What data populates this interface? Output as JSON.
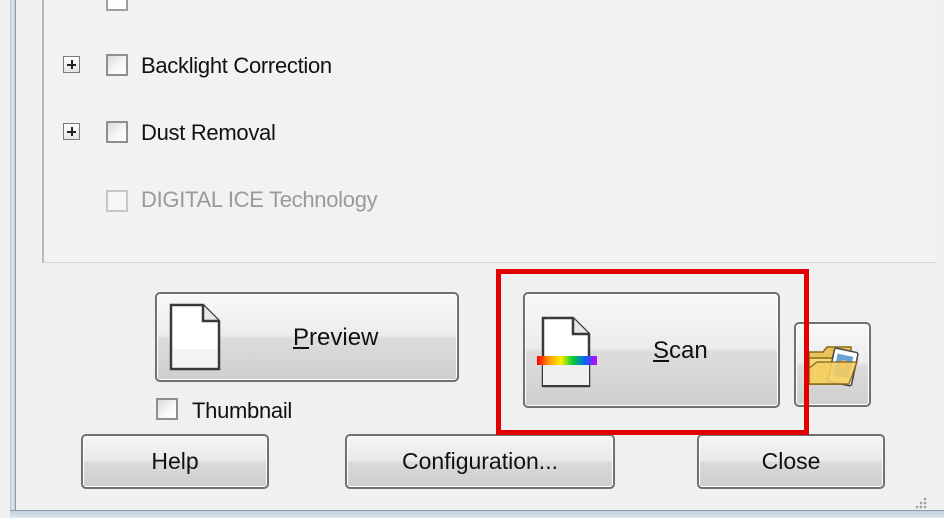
{
  "options": [
    {
      "label": "Backlight Correction",
      "enabled": true,
      "checked": false
    },
    {
      "label": "Dust Removal",
      "enabled": true,
      "checked": false
    },
    {
      "label": "DIGITAL ICE Technology",
      "enabled": false,
      "checked": false
    }
  ],
  "preview_button": {
    "mnemonic": "P",
    "rest": "review"
  },
  "scan_button": {
    "mnemonic": "S",
    "rest": "can"
  },
  "thumbnail": {
    "label": "Thumbnail",
    "checked": false
  },
  "bottom_buttons": {
    "help": "Help",
    "configuration": "Configuration...",
    "close": "Close"
  },
  "colors": {
    "highlight": "#e00000",
    "background": "#f0f0f0"
  },
  "icons": {
    "preview": "document-icon",
    "scan": "document-scan-icon",
    "folder": "folder-photo-icon"
  }
}
